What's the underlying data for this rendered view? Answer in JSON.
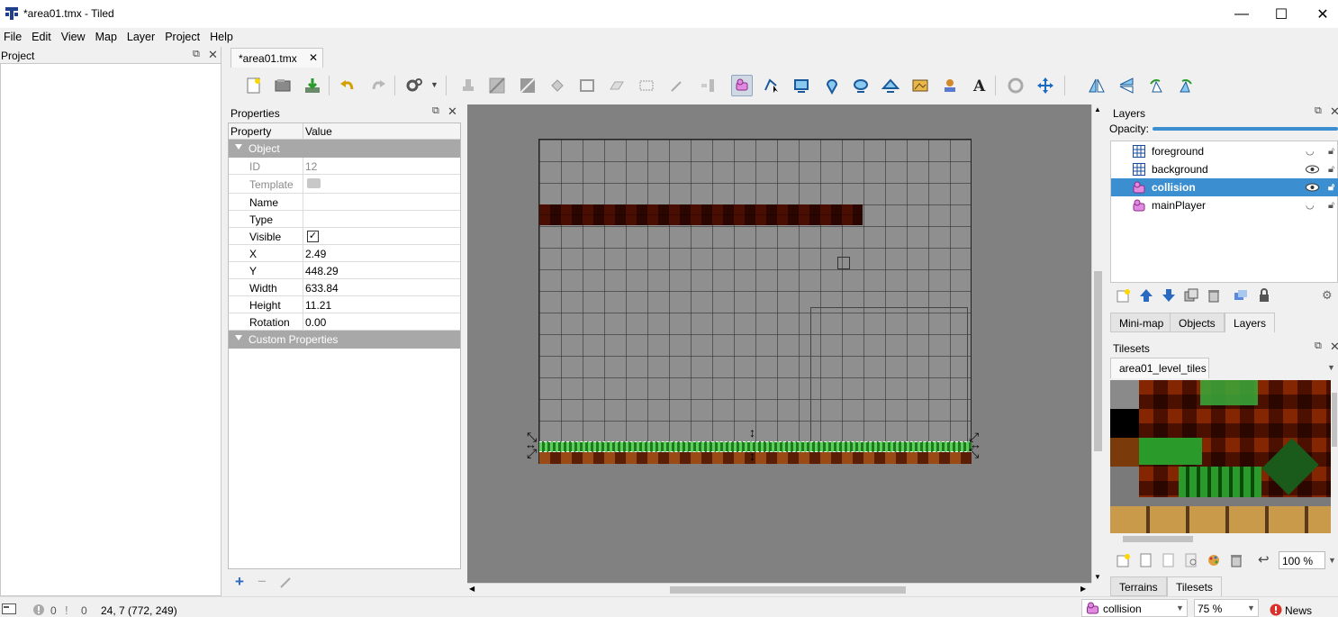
{
  "window": {
    "title": "*area01.tmx - Tiled",
    "minimize": "—",
    "maximize": "☐",
    "close": "✕"
  },
  "menubar": [
    "File",
    "Edit",
    "View",
    "Map",
    "Layer",
    "Project",
    "Help"
  ],
  "project_panel": {
    "title": "Project"
  },
  "document_tab": {
    "label": "*area01.tmx",
    "close": "✕"
  },
  "properties": {
    "title": "Properties",
    "col_property": "Property",
    "col_value": "Value",
    "group_object": "Object",
    "rows": [
      {
        "name": "ID",
        "value": "12",
        "muted": true
      },
      {
        "name": "Template",
        "value": "",
        "muted": true
      },
      {
        "name": "Name",
        "value": ""
      },
      {
        "name": "Type",
        "value": ""
      },
      {
        "name": "Visible",
        "value": "✓"
      },
      {
        "name": "X",
        "value": "2.49"
      },
      {
        "name": "Y",
        "value": "448.29"
      },
      {
        "name": "Width",
        "value": "633.84"
      },
      {
        "name": "Height",
        "value": "11.21"
      },
      {
        "name": "Rotation",
        "value": "0.00"
      }
    ],
    "group_custom": "Custom Properties",
    "add": "+",
    "remove": "−"
  },
  "layers": {
    "title": "Layers",
    "opacity_label": "Opacity:",
    "opacity": 1.0,
    "items": [
      {
        "name": "foreground",
        "kind": "tile",
        "visible": false
      },
      {
        "name": "background",
        "kind": "tile",
        "visible": true
      },
      {
        "name": "collision",
        "kind": "object",
        "visible": true,
        "selected": true
      },
      {
        "name": "mainPlayer",
        "kind": "object",
        "visible": false
      }
    ],
    "tabs": [
      "Mini-map",
      "Objects",
      "Layers"
    ],
    "active_tab": "Layers"
  },
  "tilesets": {
    "title": "Tilesets",
    "tab": "area01_level_tiles",
    "zoom": "100 %",
    "tabs": [
      "Terrains",
      "Tilesets"
    ],
    "active_tab": "Tilesets"
  },
  "statusbar": {
    "errors": "0",
    "warnings": "0",
    "coords": "24, 7 (772, 249)",
    "layer": "collision",
    "zoom": "75 %",
    "news": "News"
  },
  "colors": {
    "selection": "#3b8fd0",
    "canvas": "#818181",
    "grass": "#2f9a2f",
    "brick": "#8a3a0c"
  }
}
